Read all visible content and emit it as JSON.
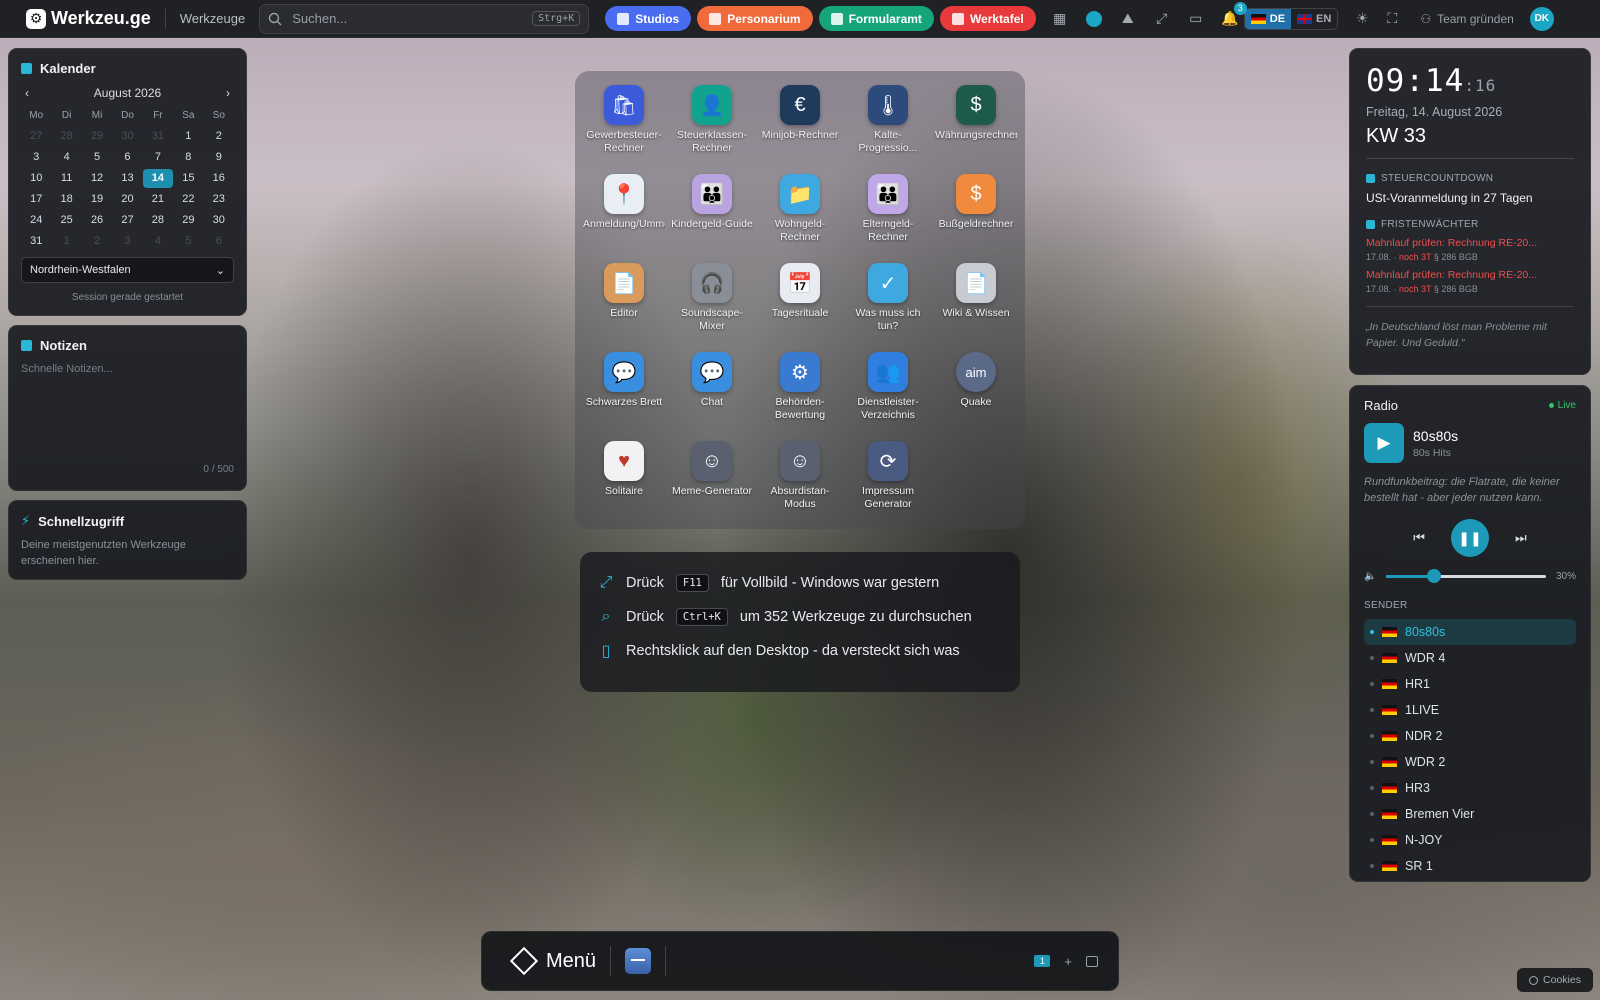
{
  "topbar": {
    "logo": "Werkzeu.ge",
    "logo_glyph": "⚙",
    "nav_link": "Werkzeuge",
    "search_placeholder": "Suchen...",
    "search_shortcut": "Strg+K",
    "pills": [
      {
        "label": "Studios",
        "color": "#4a6cf0"
      },
      {
        "label": "Personarium",
        "color": "#f06a3c"
      },
      {
        "label": "Formularamt",
        "color": "#16a57a"
      },
      {
        "label": "Werktafel",
        "color": "#e83a3a"
      }
    ],
    "notification_count": "3",
    "lang_de": "DE",
    "lang_en": "EN",
    "team": "Team gründen",
    "avatar": "DK"
  },
  "calendar": {
    "title": "Kalender",
    "month": "August 2026",
    "prev": "‹",
    "next": "›",
    "weekdays": [
      "Mo",
      "Di",
      "Mi",
      "Do",
      "Fr",
      "Sa",
      "So"
    ],
    "days": [
      {
        "d": "27",
        "m": true
      },
      {
        "d": "28",
        "m": true
      },
      {
        "d": "29",
        "m": true
      },
      {
        "d": "30",
        "m": true
      },
      {
        "d": "31",
        "m": true
      },
      {
        "d": "1"
      },
      {
        "d": "2"
      },
      {
        "d": "3"
      },
      {
        "d": "4"
      },
      {
        "d": "5"
      },
      {
        "d": "6"
      },
      {
        "d": "7"
      },
      {
        "d": "8"
      },
      {
        "d": "9"
      },
      {
        "d": "10"
      },
      {
        "d": "11"
      },
      {
        "d": "12"
      },
      {
        "d": "13"
      },
      {
        "d": "14",
        "t": true
      },
      {
        "d": "15"
      },
      {
        "d": "16"
      },
      {
        "d": "17"
      },
      {
        "d": "18"
      },
      {
        "d": "19"
      },
      {
        "d": "20"
      },
      {
        "d": "21"
      },
      {
        "d": "22"
      },
      {
        "d": "23"
      },
      {
        "d": "24"
      },
      {
        "d": "25"
      },
      {
        "d": "26"
      },
      {
        "d": "27"
      },
      {
        "d": "28"
      },
      {
        "d": "29"
      },
      {
        "d": "30"
      },
      {
        "d": "31"
      },
      {
        "d": "1",
        "m": true
      },
      {
        "d": "2",
        "m": true
      },
      {
        "d": "3",
        "m": true
      },
      {
        "d": "4",
        "m": true
      },
      {
        "d": "5",
        "m": true
      },
      {
        "d": "6",
        "m": true
      }
    ],
    "region": "Nordrhein-Westfalen",
    "session": "Session gerade gestartet"
  },
  "notes": {
    "title": "Notizen",
    "placeholder": "Schnelle Notizen...",
    "counter": "0 / 500"
  },
  "quick": {
    "title": "Schnellzugriff",
    "text": "Deine meistgenutzten Werkzeuge erscheinen hier."
  },
  "apps": [
    {
      "label": "Gewerbesteuer-Rechner",
      "glyph": "🛍",
      "color": "#3b5bdb"
    },
    {
      "label": "Steuerklassen-Rechner",
      "glyph": "👤",
      "color": "#12a38e"
    },
    {
      "label": "Minijob-Rechner",
      "glyph": "€",
      "color": "#1f3b5c"
    },
    {
      "label": "Kalte-Progressio...",
      "glyph": "🌡",
      "color": "#2c4a7a"
    },
    {
      "label": "Währungsrechner",
      "glyph": "$",
      "color": "#1e5a4a"
    },
    {
      "label": "Anmeldung/Ummeldung",
      "glyph": "📍",
      "color": "#e9eef5"
    },
    {
      "label": "Kindergeld-Guide",
      "glyph": "👪",
      "color": "#b9a3e0"
    },
    {
      "label": "Wohngeld-Rechner",
      "glyph": "📁",
      "color": "#3ea8e0"
    },
    {
      "label": "Elterngeld-Rechner",
      "glyph": "👪",
      "color": "#c0a8e8"
    },
    {
      "label": "Bußgeldrechner",
      "glyph": "$",
      "color": "#f08a3c"
    },
    {
      "label": "Editor",
      "glyph": "📄",
      "color": "#d99a5c"
    },
    {
      "label": "Soundscape-Mixer",
      "glyph": "🎧",
      "color": "#8a8e96"
    },
    {
      "label": "Tagesrituale",
      "glyph": "📅",
      "color": "#e8ecf2"
    },
    {
      "label": "Was muss ich tun?",
      "glyph": "✓",
      "color": "#3ea8e0"
    },
    {
      "label": "Wiki & Wissen",
      "glyph": "📄",
      "color": "#c8ccd2"
    },
    {
      "label": "Schwarzes Brett",
      "glyph": "💬",
      "color": "#3a8ee0"
    },
    {
      "label": "Chat",
      "glyph": "💬",
      "color": "#3a8ee0"
    },
    {
      "label": "Behörden-Bewertung",
      "glyph": "⚙",
      "color": "#3a7ad0"
    },
    {
      "label": "Dienstleister-Verzeichnis",
      "glyph": "👥",
      "color": "#2f7ee0"
    },
    {
      "label": "Quake",
      "glyph": "aim",
      "color": "#5a6a88"
    },
    {
      "label": "Solitaire",
      "glyph": "♥",
      "color": "#f2f2f4"
    },
    {
      "label": "Meme-Generator",
      "glyph": "☺",
      "color": "#5a6070"
    },
    {
      "label": "Absurdistan-Modus",
      "glyph": "☺",
      "color": "#5a6070"
    },
    {
      "label": "Impressum Generator",
      "glyph": "⟳",
      "color": "#4a5a80"
    }
  ],
  "tips": [
    {
      "icon": "⤢",
      "pre": "Drück",
      "key": "F11",
      "post": "für Vollbild - Windows war gestern"
    },
    {
      "icon": "⌕",
      "pre": "Drück",
      "key": "Ctrl+K",
      "post": "um 352 Werkzeuge zu durchsuchen"
    },
    {
      "icon": "▯",
      "pre": "",
      "key": "",
      "post": "Rechtsklick auf den Desktop - da versteckt sich was"
    }
  ],
  "clock": {
    "time": "09:14",
    "seconds": ":16",
    "date": "Freitag, 14. August 2026",
    "week": "KW 33",
    "countdown_label": "STEUERCOUNTDOWN",
    "countdown_text": "USt-Voranmeldung in 27 Tagen",
    "deadline_label": "FRISTENWÄCHTER",
    "deadlines": [
      {
        "title": "Mahnlauf prüfen: Rechnung RE-20...",
        "date": "17.08.",
        "left": "noch 3T",
        "law": "§ 286 BGB"
      },
      {
        "title": "Mahnlauf prüfen: Rechnung RE-20...",
        "date": "17.08.",
        "left": "noch 3T",
        "law": "§ 286 BGB"
      }
    ],
    "quote": "„In Deutschland löst man Probleme mit Papier. Und Geduld.\""
  },
  "radio": {
    "title": "Radio",
    "live": "Live",
    "station": "80s80s",
    "genre": "80s Hits",
    "quote": "Rundfunkbeitrag: die Flatrate, die keiner bestellt hat - aber jeder nutzen kann.",
    "volume": 30,
    "volume_label": "30%",
    "sender_label": "SENDER",
    "stations": [
      "80s80s",
      "WDR 4",
      "HR1",
      "1LIVE",
      "NDR 2",
      "WDR 2",
      "HR3",
      "Bremen Vier",
      "N-JOY",
      "SR 1"
    ],
    "active_station": "80s80s"
  },
  "taskbar": {
    "menu": "Menü",
    "workspace": "1",
    "add": "+"
  },
  "cookies": "Cookies"
}
